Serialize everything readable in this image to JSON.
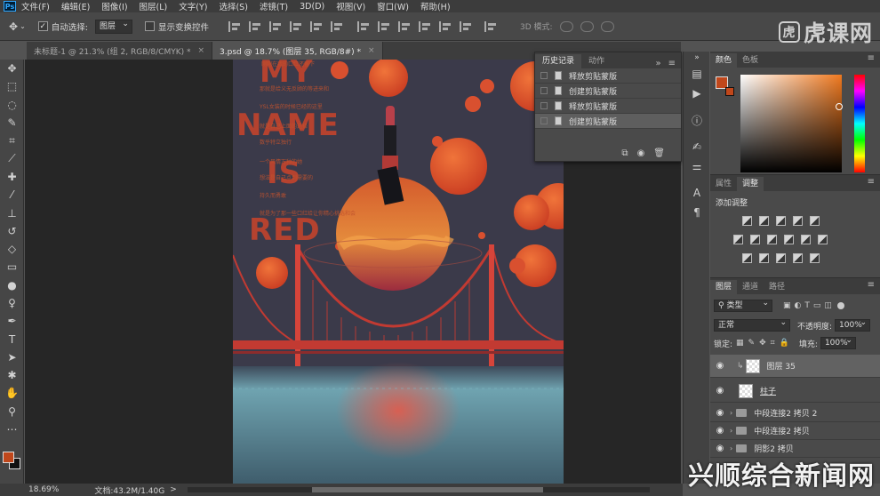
{
  "app": {
    "logo": "Ps"
  },
  "menubar": {
    "items": [
      "文件(F)",
      "编辑(E)",
      "图像(I)",
      "图层(L)",
      "文字(Y)",
      "选择(S)",
      "滤镜(T)",
      "3D(D)",
      "视图(V)",
      "窗口(W)",
      "帮助(H)"
    ]
  },
  "options": {
    "auto_select_label": "自动选择:",
    "auto_select_checked": "✓",
    "auto_select_target": "图层",
    "show_transform_label": "显示变换控件",
    "mode_3d_label": "3D 模式:"
  },
  "tabs": [
    {
      "label": "未标题-1 @ 21.3% (组 2, RGB/8/CMYK) *",
      "close": "×"
    },
    {
      "label": "3.psd @ 18.7% (图层 35, RGB/8#) *",
      "close": "×"
    }
  ],
  "poster": {
    "line1": "MY",
    "line2": "NAME",
    "line3": "IS",
    "line4": "RED",
    "small_texts": [
      "刚刚在我的口红还留下",
      "那就是给义无反顾的等进来和",
      "YSL女装的时候已经的这里",
      "就是自己上面的选择",
      "数乎特立独行",
      "一个风情万种的她",
      "想法是自己点到需要的",
      "持久而勇敢",
      "就是为了那一些口红给让你精心挑选和会"
    ],
    "colors": {
      "bg": "#3b3a4a",
      "accent": "#d9502f",
      "bridge": "#c23a32",
      "water": "#6fa3b0"
    }
  },
  "history": {
    "tabs": [
      "历史记录",
      "动作"
    ],
    "menu_icon": "»",
    "rows": [
      "释放剪贴蒙版",
      "创建剪贴蒙版",
      "释放剪贴蒙版",
      "创建剪贴蒙版"
    ],
    "footer_icons": [
      "new-snapshot-icon",
      "camera-icon",
      "trash-icon"
    ]
  },
  "panels": {
    "color_tabs": [
      "颜色",
      "色板"
    ],
    "adjust_tabs": [
      "属性",
      "调整"
    ],
    "adjust_title": "添加调整",
    "layers_tabs": [
      "图层",
      "通道",
      "路径"
    ]
  },
  "layers": {
    "filter_kind": "类型",
    "blend_mode": "正常",
    "opacity_label": "不透明度:",
    "opacity_value": "100%",
    "lock_label": "锁定:",
    "fill_label": "填充:",
    "fill_value": "100%",
    "items": [
      {
        "name": "图层 35",
        "selected": true
      },
      {
        "name": "柱子"
      },
      {
        "name": "中段连接2 拷贝 2"
      },
      {
        "name": "中段连接2 拷贝"
      },
      {
        "name": "阴影2 拷贝"
      }
    ]
  },
  "status": {
    "zoom": "18.69%",
    "docinfo": "文档:43.2M/1.40G",
    "arrow": ">"
  },
  "watermark": {
    "badge": "虎",
    "text": "虎课网"
  },
  "corner_logo": "兴顺综合新闻网"
}
